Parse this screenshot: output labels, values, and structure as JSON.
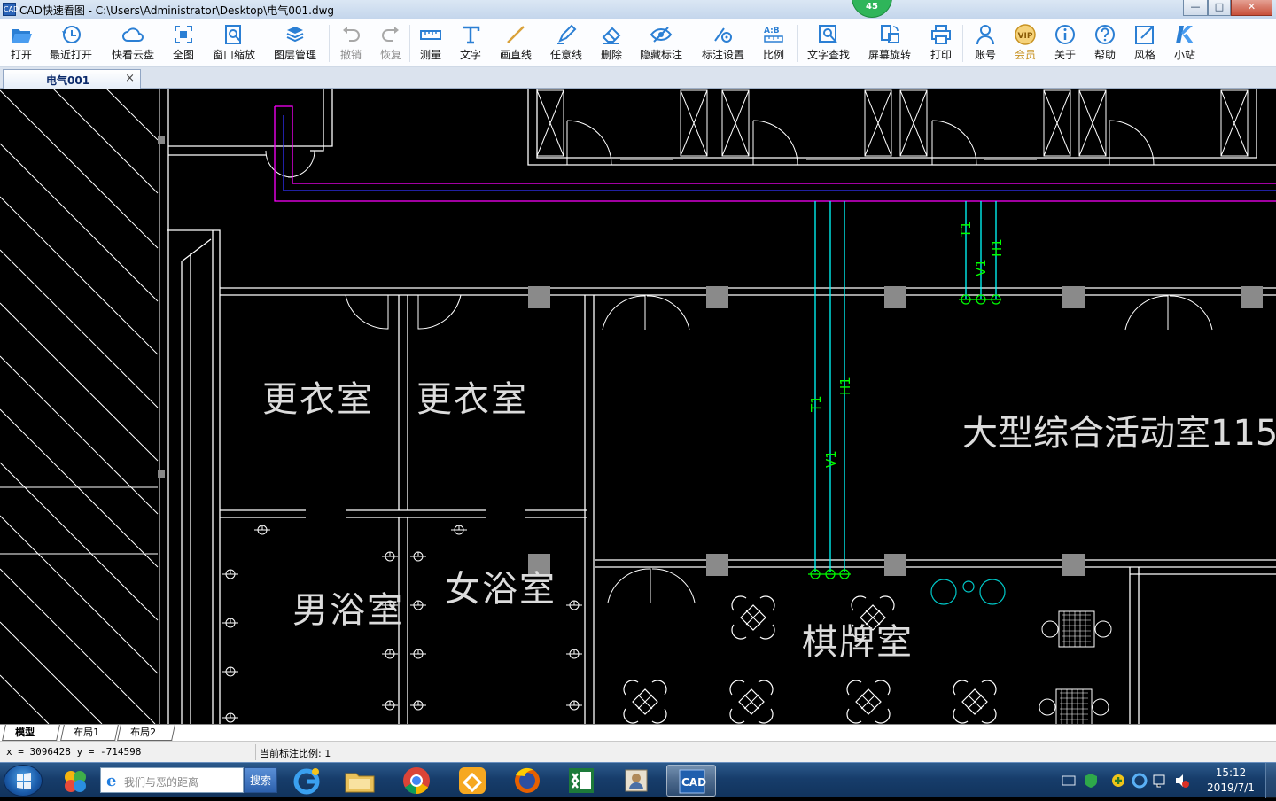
{
  "window": {
    "title": "CAD快速看图 - C:\\Users\\Administrator\\Desktop\\电气001.dwg",
    "app_icon": "CAD",
    "badge": "45",
    "controls": {
      "minimize": "—",
      "maximize": "□",
      "close": "✕"
    }
  },
  "toolbar": {
    "items": [
      {
        "label": "打开",
        "icon": "folder-open-icon"
      },
      {
        "label": "最近打开",
        "icon": "clock-history-icon"
      },
      {
        "label": "快看云盘",
        "icon": "cloud-icon"
      },
      {
        "label": "全图",
        "icon": "fit-all-icon"
      },
      {
        "label": "窗口缩放",
        "icon": "zoom-window-icon"
      },
      {
        "label": "图层管理",
        "icon": "layers-icon"
      },
      {
        "label": "撤销",
        "icon": "undo-icon",
        "disabled": true
      },
      {
        "label": "恢复",
        "icon": "redo-icon",
        "disabled": true
      },
      {
        "label": "测量",
        "icon": "ruler-icon"
      },
      {
        "label": "文字",
        "icon": "text-t-icon"
      },
      {
        "label": "画直线",
        "icon": "line-icon"
      },
      {
        "label": "任意线",
        "icon": "pencil-icon"
      },
      {
        "label": "删除",
        "icon": "eraser-icon"
      },
      {
        "label": "隐藏标注",
        "icon": "eye-hidden-icon"
      },
      {
        "label": "标注设置",
        "icon": "annotation-settings-icon"
      },
      {
        "label": "比例",
        "icon": "scale-ab-icon"
      },
      {
        "label": "文字查找",
        "icon": "text-search-icon"
      },
      {
        "label": "屏幕旋转",
        "icon": "screen-rotate-icon"
      },
      {
        "label": "打印",
        "icon": "printer-icon"
      },
      {
        "label": "账号",
        "icon": "user-account-icon"
      },
      {
        "label": "会员",
        "icon": "vip-icon",
        "vip": true
      },
      {
        "label": "关于",
        "icon": "info-icon"
      },
      {
        "label": "帮助",
        "icon": "help-icon"
      },
      {
        "label": "风格",
        "icon": "style-icon"
      },
      {
        "label": "小站",
        "icon": "k-logo-icon"
      }
    ]
  },
  "document_tab": {
    "label": "电气001",
    "close": "×"
  },
  "drawing": {
    "room_labels": [
      "更衣室",
      "更衣室",
      "大型综合活动室115",
      "男浴室",
      "女浴室",
      "棋牌室"
    ],
    "cable_tags": [
      "T1",
      "V1",
      "H1",
      "T1",
      "V1",
      "H1"
    ],
    "colors": {
      "background": "#000000",
      "walls": "#ffffff",
      "cable_magenta": "#ff00ff",
      "cable_blue": "#0000ff",
      "cable_cyan": "#00ffff",
      "cable_green": "#00ff00",
      "text": "#dcdcdc"
    }
  },
  "layout_tabs": [
    {
      "label": "模型",
      "active": true
    },
    {
      "label": "布局1"
    },
    {
      "label": "布局2"
    }
  ],
  "status": {
    "coordinates": "x = 3096428 y = -714598",
    "scale": "当前标注比例: 1"
  },
  "taskbar": {
    "search_placeholder": "我们与恶的距离",
    "search_button": "搜索",
    "apps": [
      "windows-logo-icon",
      "ie-icon",
      "explorer-icon",
      "chrome-icon",
      "app-orange-icon",
      "firefox-icon",
      "excel-icon",
      "user-card-icon",
      "cad-app-icon"
    ],
    "clock_time": "15:12",
    "clock_date": "2019/7/1"
  }
}
